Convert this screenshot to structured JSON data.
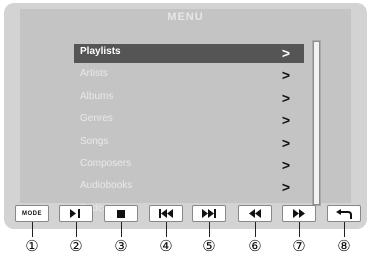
{
  "screen": {
    "title": "MENU"
  },
  "menu": {
    "items": [
      {
        "label": "Playlists",
        "selected": true
      },
      {
        "label": "Artists",
        "selected": false
      },
      {
        "label": "Albums",
        "selected": false
      },
      {
        "label": "Genres",
        "selected": false
      },
      {
        "label": "Songs",
        "selected": false
      },
      {
        "label": "Composers",
        "selected": false
      },
      {
        "label": "Audiobooks",
        "selected": false
      },
      {
        "label": "Podcasts",
        "selected": false
      }
    ],
    "chevron": ">"
  },
  "controls": {
    "mode_label": "MODE"
  },
  "callouts": [
    "①",
    "②",
    "③",
    "④",
    "⑤",
    "⑥",
    "⑦",
    "⑧"
  ]
}
